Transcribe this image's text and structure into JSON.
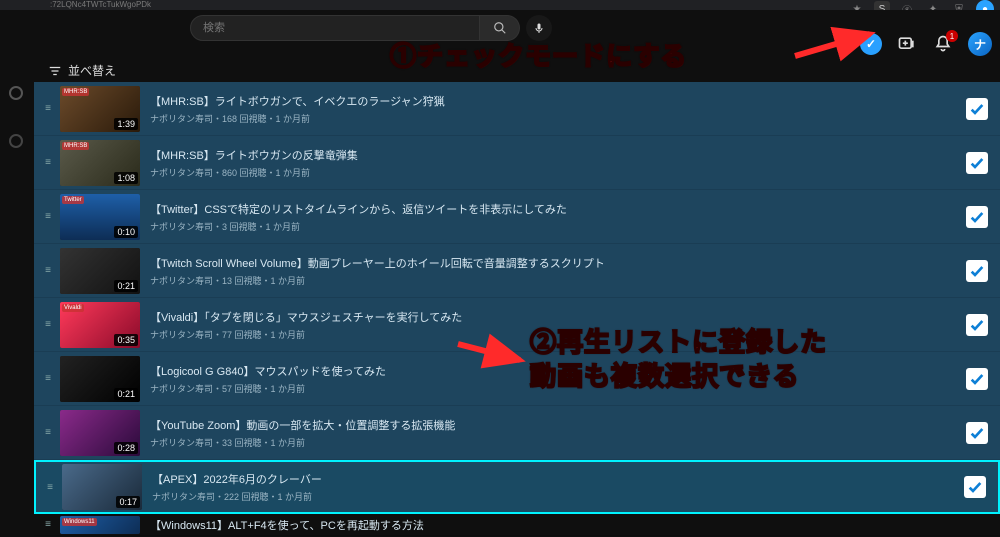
{
  "url_fragment": ":72LQNc4TWTcTukWgoPDk",
  "search": {
    "placeholder": "検索"
  },
  "top_icons": {
    "check_mode": "✓",
    "notification_count": "1"
  },
  "sort_label": "並べ替え",
  "rows": [
    {
      "title": "【MHR:SB】ライトボウガンで、イベクエのラージャン狩猟",
      "sub": "ナポリタン寿司・168 回視聴・1 か月前",
      "duration": "1:39",
      "badge": "MHR:SB"
    },
    {
      "title": "【MHR:SB】ライトボウガンの反撃竜弾集",
      "sub": "ナポリタン寿司・860 回視聴・1 か月前",
      "duration": "1:08",
      "badge": "MHR:SB"
    },
    {
      "title": "【Twitter】CSSで特定のリストタイムラインから、返信ツイートを非表示にしてみた",
      "sub": "ナポリタン寿司・3 回視聴・1 か月前",
      "duration": "0:10",
      "badge": "Twitter"
    },
    {
      "title": "【Twitch Scroll Wheel Volume】動画プレーヤー上のホイール回転で音量調整するスクリプト",
      "sub": "ナポリタン寿司・13 回視聴・1 か月前",
      "duration": "0:21",
      "badge": ""
    },
    {
      "title": "【Vivaldi】「タブを閉じる」マウスジェスチャーを実行してみた",
      "sub": "ナポリタン寿司・77 回視聴・1 か月前",
      "duration": "0:35",
      "badge": "Vivaldi"
    },
    {
      "title": "【Logicool G G840】マウスパッドを使ってみた",
      "sub": "ナポリタン寿司・57 回視聴・1 か月前",
      "duration": "0:21",
      "badge": ""
    },
    {
      "title": "【YouTube Zoom】動画の一部を拡大・位置調整する拡張機能",
      "sub": "ナポリタン寿司・33 回視聴・1 か月前",
      "duration": "0:28",
      "badge": ""
    },
    {
      "title": "【APEX】2022年6月のクレーバー",
      "sub": "ナポリタン寿司・222 回視聴・1 か月前",
      "duration": "0:17",
      "badge": "",
      "selected": true
    },
    {
      "title": "【Windows11】ALT+F4を使って、PCを再起動する方法",
      "sub": "",
      "duration": "",
      "badge": "Windows11",
      "last": true
    }
  ],
  "annotations": {
    "a1": "①チェックモードにする",
    "a2_line1": "②再生リストに登録した",
    "a2_line2": "動画も複数選択できる"
  },
  "thumb_colors": [
    "linear-gradient(135deg,#6b4a2a,#2a1a0a)",
    "linear-gradient(135deg,#5a5a4a,#2a2a1a)",
    "linear-gradient(180deg,#1e5fa8,#0d2d55)",
    "linear-gradient(135deg,#333,#111)",
    "linear-gradient(135deg,#ff3a5a,#8a0a2a)",
    "linear-gradient(135deg,#222,#000)",
    "linear-gradient(135deg,#8a2a8a,#2a0a3a)",
    "linear-gradient(135deg,#4a6a8a,#1a2a3a)",
    "linear-gradient(135deg,#1e5fa8,#0d2d55)"
  ]
}
